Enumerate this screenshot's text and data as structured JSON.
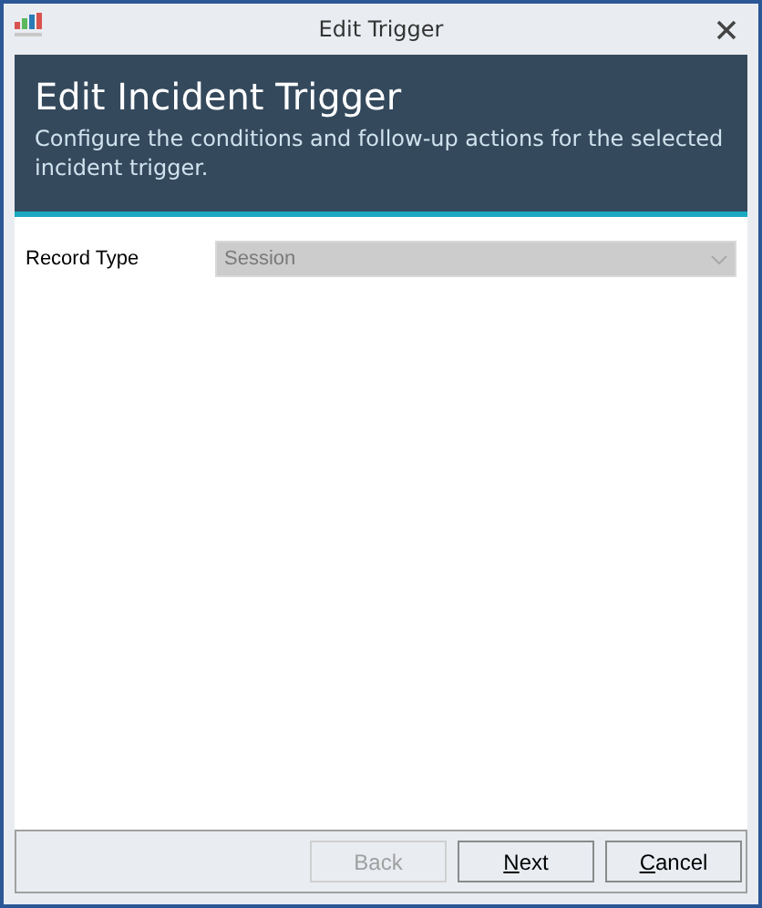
{
  "window": {
    "title": "Edit Trigger"
  },
  "header": {
    "title": "Edit Incident Trigger",
    "subtitle": "Configure the conditions and follow-up actions for the selected incident trigger."
  },
  "fields": [
    {
      "label": "Record Type",
      "value": "Session",
      "disabled": true
    }
  ],
  "buttons": [
    {
      "label": "Back",
      "disabled": true,
      "mnemonic": false
    },
    {
      "label": "Next",
      "disabled": false,
      "mnemonic": true
    },
    {
      "label": "Cancel",
      "disabled": false,
      "mnemonic": true
    }
  ]
}
